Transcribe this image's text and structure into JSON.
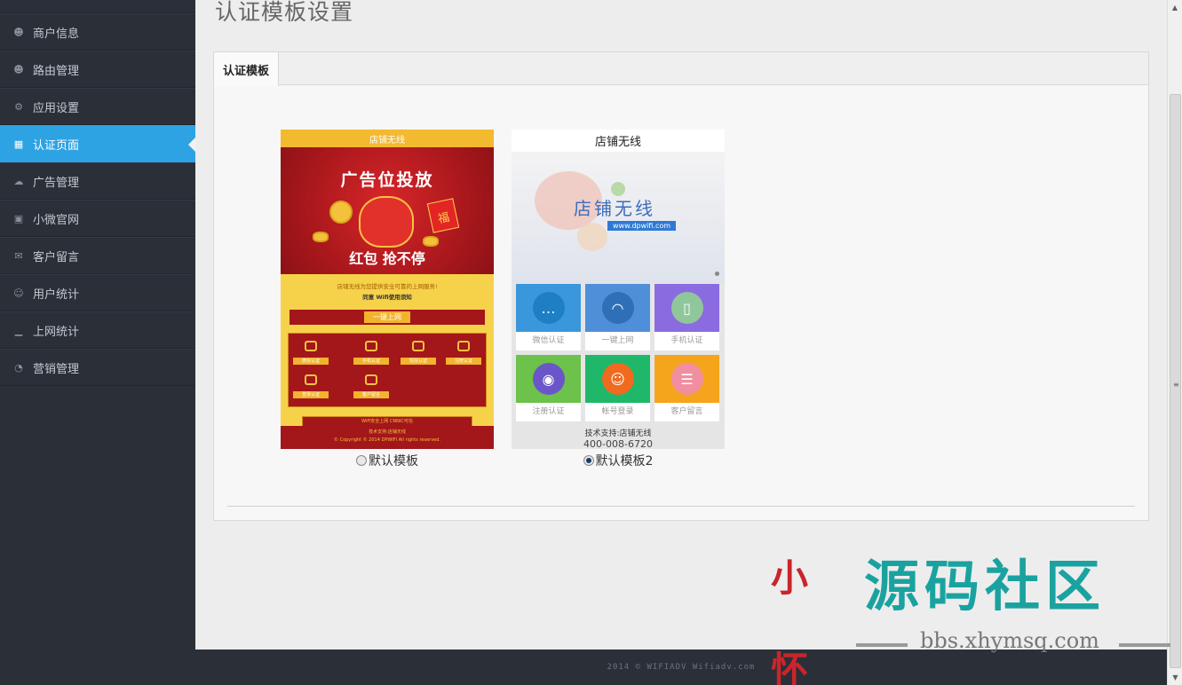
{
  "sidebar": {
    "items": [
      {
        "label": "商户信息",
        "icon": "users-icon",
        "active": false
      },
      {
        "label": "路由管理",
        "icon": "users-icon",
        "active": false
      },
      {
        "label": "应用设置",
        "icon": "cogs-icon",
        "active": false
      },
      {
        "label": "认证页面",
        "icon": "table-icon",
        "active": true
      },
      {
        "label": "广告管理",
        "icon": "cloud-icon",
        "active": false
      },
      {
        "label": "小微官网",
        "icon": "grid-icon",
        "active": false
      },
      {
        "label": "客户留言",
        "icon": "envelope-icon",
        "active": false
      },
      {
        "label": "用户统计",
        "icon": "user-icon",
        "active": false
      },
      {
        "label": "上网统计",
        "icon": "signal-icon",
        "active": false
      },
      {
        "label": "营销管理",
        "icon": "dashboard-icon",
        "active": false
      }
    ]
  },
  "main": {
    "page_title": "认证模板设置",
    "tab_label": "认证模板",
    "templates": [
      {
        "option_label": "默认模板",
        "selected": false,
        "preview": {
          "header": "店铺无线",
          "banner_title": "广告位投放",
          "banner_text": "红包 抢不停",
          "envelope_char": "福",
          "notice": "店铺无线为您提供安全可靠的上网服务!",
          "agree": "同意 Wifi使用须知",
          "button": "一键上网",
          "cells": [
            "微信认证",
            "手机认证",
            "短信认证",
            "注册认证",
            "登录认证",
            "客户留言"
          ],
          "wifi_bar": "WiFi安全上网  CNNIC可信",
          "support": "技术支持:店铺无线",
          "copyright": "© Copyright © 2014 DPWIFI All rights reserved."
        }
      },
      {
        "option_label": "默认模板2",
        "selected": true,
        "preview": {
          "header": "店铺无线",
          "brand": "店铺无线",
          "url": "www.dpwifi.com",
          "tiles": [
            {
              "label": "微信认证",
              "color": "#3a97dc",
              "circle": "#1f7fc4",
              "icon": "wechat-icon"
            },
            {
              "label": "一键上网",
              "color": "#4f8fd9",
              "circle": "#2f6fb8",
              "icon": "wifi-icon"
            },
            {
              "label": "手机认证",
              "color": "#8b6be0",
              "circle": "#8fc79a",
              "icon": "phone-icon"
            },
            {
              "label": "注册认证",
              "color": "#6cc24a",
              "circle": "#6a56c9",
              "icon": "eye-icon"
            },
            {
              "label": "帐号登录",
              "color": "#1fb86a",
              "circle": "#f06a1f",
              "icon": "account-icon"
            },
            {
              "label": "客户留言",
              "color": "#f4a51c",
              "circle": "#f18ea0",
              "icon": "note-icon"
            }
          ],
          "support": "技术支持:店铺无线",
          "phone": "400-008-6720"
        }
      }
    ]
  },
  "footer": {
    "text": "2014 © WIFIADV Wifiadv.com"
  },
  "watermark": {
    "seal": "小   怀",
    "title": "源码社区",
    "site": "bbs.xhymsq.com"
  }
}
